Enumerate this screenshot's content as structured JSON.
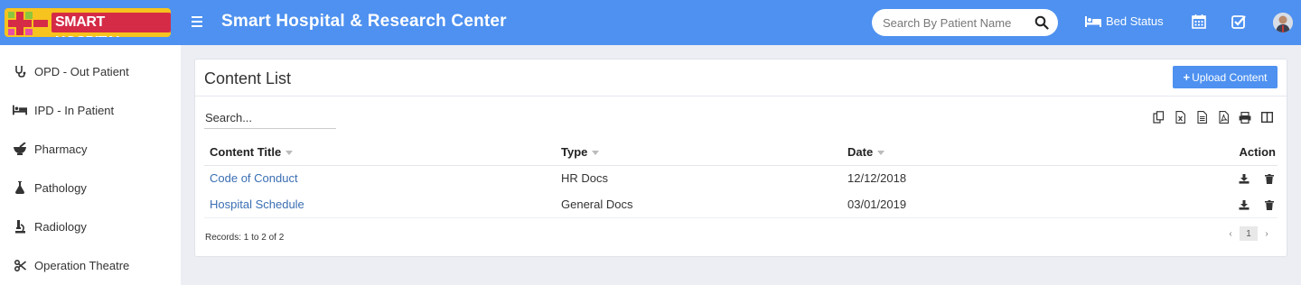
{
  "brand": {
    "logo_text": "SMART HOSPITAL",
    "colors": {
      "header": "#4e91f0",
      "logo_bg": "#f7c31e",
      "logo_red": "#d52b47"
    }
  },
  "header": {
    "title": "Smart Hospital & Research Center",
    "search_placeholder": "Search By Patient Name",
    "bed_status": "Bed Status",
    "icons": [
      "menu-icon",
      "search-icon",
      "bed-icon",
      "calendar-icon",
      "task-check-icon",
      "user-avatar"
    ]
  },
  "sidebar": {
    "items": [
      {
        "label": "OPD - Out Patient",
        "icon": "stethoscope-icon"
      },
      {
        "label": "IPD - In Patient",
        "icon": "hospital-bed-icon"
      },
      {
        "label": "Pharmacy",
        "icon": "mortar-pestle-icon"
      },
      {
        "label": "Pathology",
        "icon": "flask-icon"
      },
      {
        "label": "Radiology",
        "icon": "microscope-icon"
      },
      {
        "label": "Operation Theatre",
        "icon": "scissors-icon"
      }
    ]
  },
  "content": {
    "title": "Content List",
    "upload_button": "Upload Content",
    "search_placeholder": "Search...",
    "export_tools": [
      "copy-icon",
      "excel-icon",
      "csv-icon",
      "pdf-icon",
      "print-icon",
      "columns-icon"
    ],
    "columns": [
      "Content Title",
      "Type",
      "Date",
      "Action"
    ],
    "rows": [
      {
        "title": "Code of Conduct",
        "type": "HR Docs",
        "date": "12/12/2018"
      },
      {
        "title": "Hospital Schedule",
        "type": "General Docs",
        "date": "03/01/2019"
      }
    ],
    "records_text": "Records: 1 to 2 of 2",
    "pagination": {
      "prev": "‹",
      "current": "1",
      "next": "›"
    }
  }
}
